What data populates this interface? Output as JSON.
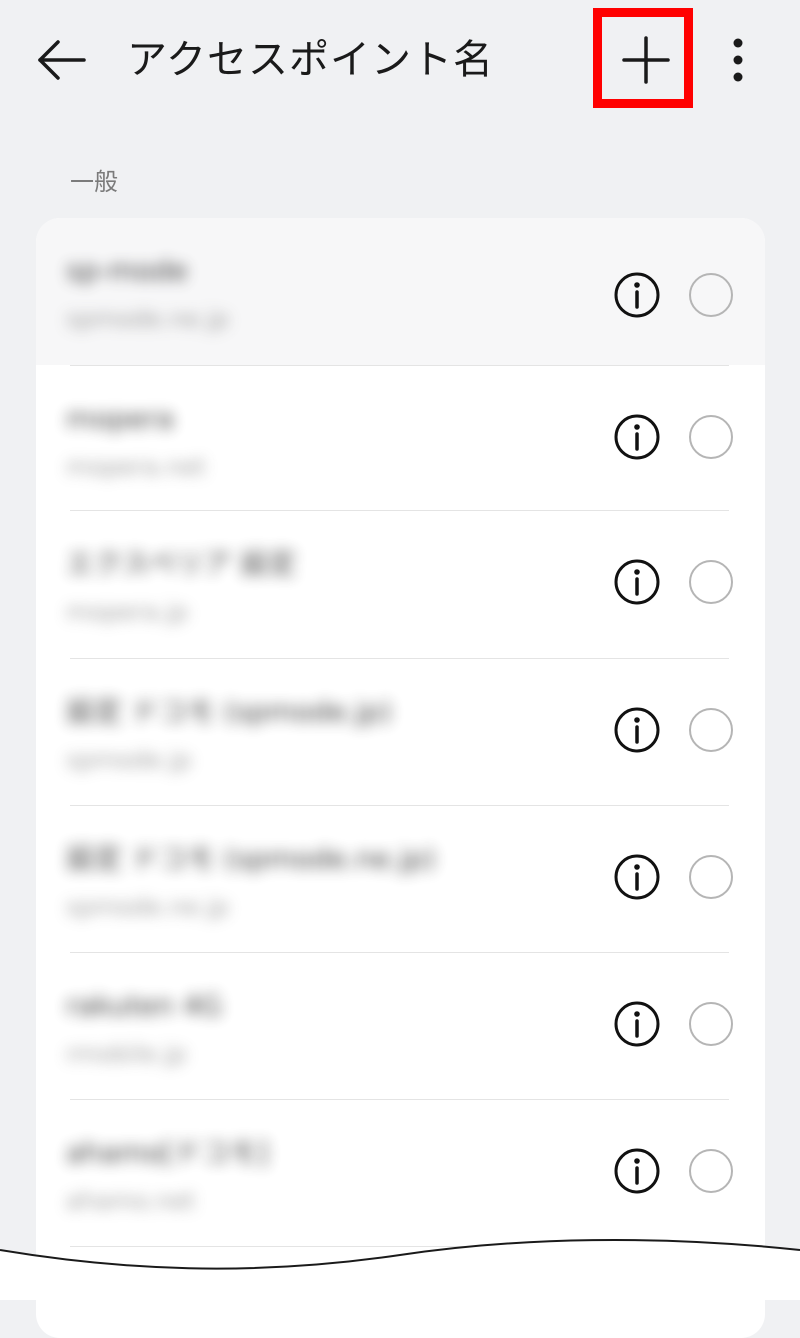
{
  "appbar": {
    "title": "アクセスポイント名",
    "back_icon": "arrow-left-icon",
    "add_icon": "plus-icon",
    "more_icon": "more-vert-icon",
    "highlight_color": "#ff0000"
  },
  "section": {
    "label": "一般"
  },
  "apn_list": [
    {
      "name": "sp-mode",
      "apn": "spmode.ne.jp",
      "selected": false
    },
    {
      "name": "mopera",
      "apn": "mopera.net",
      "selected": false
    },
    {
      "name": "エクスペリア 設定",
      "apn": "mopera.jp",
      "selected": false
    },
    {
      "name": "設定 ドコモ (spmode.jp)",
      "apn": "spmode.jp",
      "selected": false
    },
    {
      "name": "設定 ドコモ (spmode.ne.jp)",
      "apn": "spmode.ne.jp",
      "selected": false
    },
    {
      "name": "rakuten 4G",
      "apn": "rmobile.jp",
      "selected": false
    },
    {
      "name": "ahamo[ドコモ]",
      "apn": "ahamo.net",
      "selected": false
    }
  ],
  "icons": {
    "info": "info-icon",
    "radio": "radio-button-icon"
  }
}
